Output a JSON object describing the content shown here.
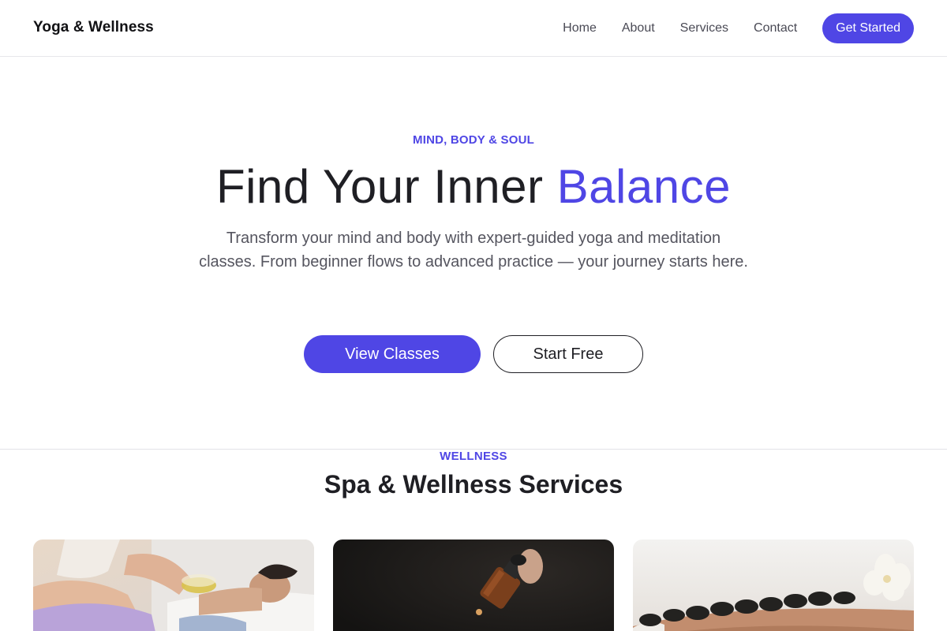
{
  "header": {
    "brand": "Yoga & Wellness",
    "nav": [
      "Home",
      "About",
      "Services",
      "Contact"
    ],
    "cta": "Get Started"
  },
  "hero": {
    "eyebrow": "MIND, BODY & SOUL",
    "headline_main": "Find Your Inner ",
    "headline_accent": "Balance",
    "lede": "Transform your mind and body with expert-guided yoga and meditation classes. From beginner flows to advanced practice — your journey starts here.",
    "primary_button": "View Classes",
    "secondary_button": "Start Free"
  },
  "services": {
    "eyebrow": "WELLNESS",
    "title": "Spa & Wellness Services",
    "cards": [
      {
        "image": "massage-oil-photo"
      },
      {
        "image": "essential-oil-dropper-photo"
      },
      {
        "image": "hot-stone-massage-photo"
      }
    ]
  },
  "colors": {
    "accent": "#4f46e5",
    "text": "#1f1f24",
    "muted": "#55555f"
  }
}
